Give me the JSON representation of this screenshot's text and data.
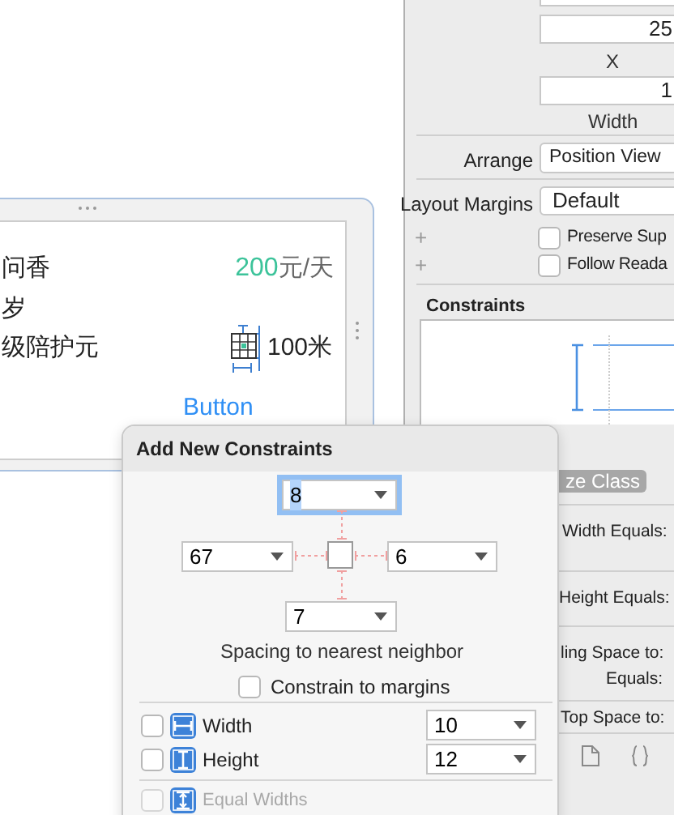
{
  "canvas": {
    "title": "问香",
    "price": "200",
    "unit": "元/天",
    "age": "岁",
    "service": "级陪护元",
    "distance": "100米",
    "button": "Button"
  },
  "inspector": {
    "fields": [
      {
        "value": "25",
        "label": "X"
      },
      {
        "value": "1",
        "label": "Width"
      }
    ],
    "arrange": {
      "label": "Arrange",
      "value": "Position View"
    },
    "layout_margins": {
      "label": "Layout Margins",
      "value": "Default"
    },
    "options": [
      {
        "icon": "+",
        "label": "Preserve Sup",
        "checked": false
      },
      {
        "icon": "+",
        "label": "Follow Reada",
        "checked": false
      }
    ],
    "constraints_title": "Constraints",
    "size_class": "ze Class",
    "constraint_rows": [
      "Width Equals:",
      "Height Equals:",
      "ling Space to:",
      "Equals:",
      "Top Space to:"
    ]
  },
  "popover": {
    "title": "Add New Constraints",
    "spacing": {
      "top": {
        "value": "8",
        "focused": true
      },
      "left": {
        "value": "67",
        "focused": false
      },
      "right": {
        "value": "6",
        "focused": false
      },
      "bottom": {
        "value": "7",
        "focused": false
      }
    },
    "spacing_caption": "Spacing to nearest neighbor",
    "constrain_to_margins": {
      "label": "Constrain to margins",
      "checked": false
    },
    "size_rows": [
      {
        "kind": "width",
        "label": "Width",
        "checked": false,
        "value": "10"
      },
      {
        "kind": "height",
        "label": "Height",
        "checked": false,
        "value": "12"
      }
    ],
    "equal_widths": {
      "label": "Equal Widths",
      "checked": false,
      "disabled": true
    }
  }
}
